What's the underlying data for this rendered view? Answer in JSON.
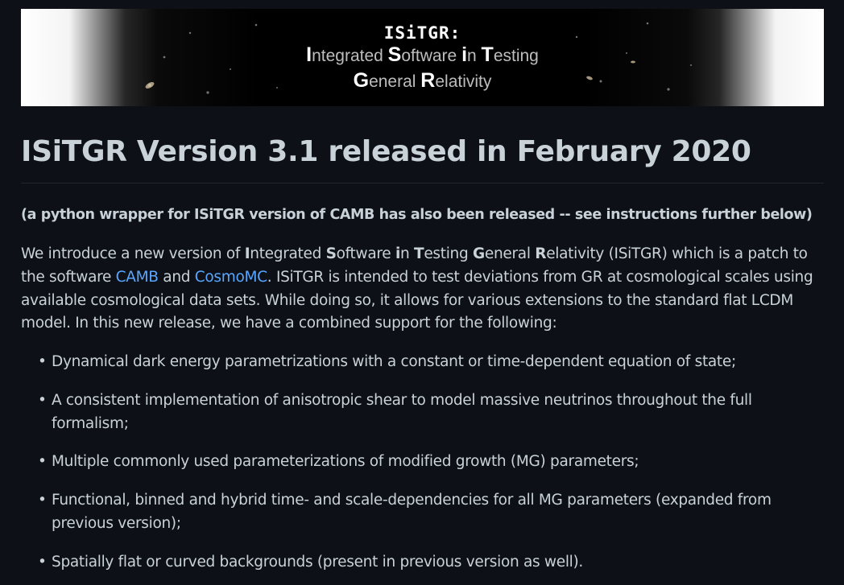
{
  "banner": {
    "title": "ISiTGR:",
    "line1": [
      {
        "cap": "I",
        "rest": "ntegrated "
      },
      {
        "cap": "S",
        "rest": "oftware "
      },
      {
        "cap": "i",
        "rest": "n "
      },
      {
        "cap": "T",
        "rest": "esting"
      }
    ],
    "line2": [
      {
        "cap": "G",
        "rest": "eneral "
      },
      {
        "cap": "R",
        "rest": "elativity"
      }
    ]
  },
  "heading": "ISiTGR Version 3.1 released in February 2020",
  "subnote": "(a python wrapper for ISiTGR version of CAMB has also been released -- see instructions further below)",
  "intro": {
    "t1": "We introduce a new version of ",
    "I": "I",
    "t2": "ntegrated ",
    "S": "S",
    "t3": "oftware ",
    "i": "i",
    "t4": "n ",
    "T": "T",
    "t5": "esting ",
    "G": "G",
    "t6": "eneral ",
    "R": "R",
    "t7": "elativity (ISiTGR) which is a patch to the software ",
    "camb": "CAMB",
    "t8": " and ",
    "cosmomc": "CosmoMC",
    "t9": ". ISiTGR is intended to test deviations from GR at cosmological scales using available cosmological data sets. While doing so, it allows for various extensions to the standard flat LCDM model. In this new release, we have a combined support for the following:"
  },
  "features": [
    "Dynamical dark energy parametrizations with a constant or time-dependent equation of state;",
    "A consistent implementation of anisotropic shear to model massive neutrinos throughout the full formalism;",
    "Multiple commonly used parameterizations of modified growth (MG) parameters;",
    "Functional, binned and hybrid time- and scale-dependencies for all MG parameters (expanded from previous version);",
    "Spatially flat or curved backgrounds (present in previous version as well)."
  ],
  "bullet": "•",
  "colors": {
    "background": "#0d1117",
    "text": "#c9d1d9",
    "link": "#58a6ff"
  }
}
